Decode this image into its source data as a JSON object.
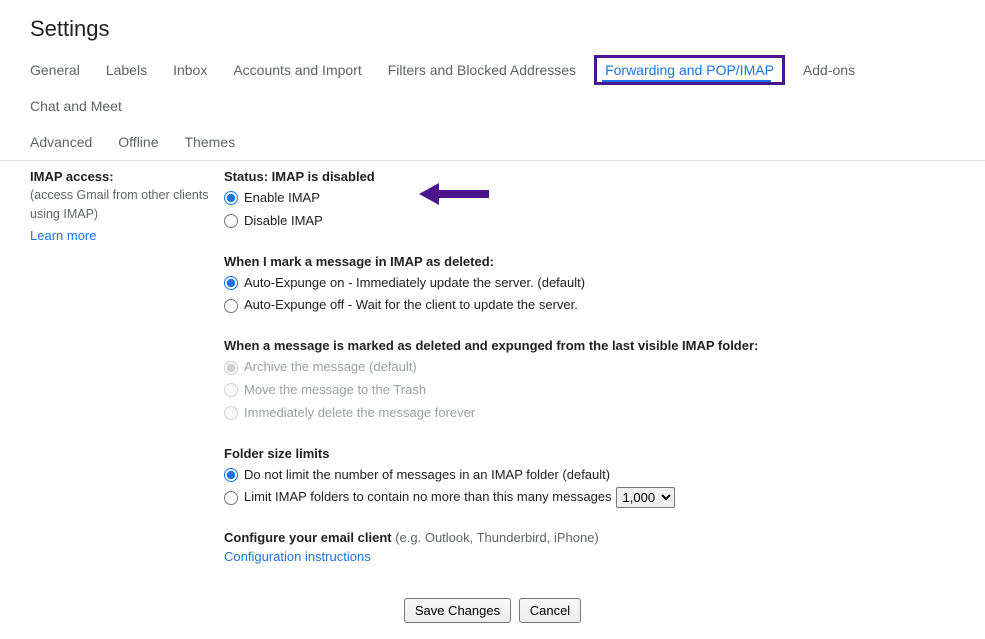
{
  "page_title": "Settings",
  "tabs": {
    "general": "General",
    "labels": "Labels",
    "inbox": "Inbox",
    "accounts": "Accounts and Import",
    "filters": "Filters and Blocked Addresses",
    "forwarding": "Forwarding and POP/IMAP",
    "addons": "Add-ons",
    "chat": "Chat and Meet",
    "advanced": "Advanced",
    "offline": "Offline",
    "themes": "Themes"
  },
  "left": {
    "title": "IMAP access:",
    "desc": "(access Gmail from other clients using IMAP)",
    "learn": "Learn more"
  },
  "status": {
    "title": "Status: IMAP is disabled",
    "enable": "Enable IMAP",
    "disable": "Disable IMAP"
  },
  "deleted": {
    "title": "When I mark a message in IMAP as deleted:",
    "opt_on": "Auto-Expunge on - Immediately update the server. (default)",
    "opt_off": "Auto-Expunge off - Wait for the client to update the server."
  },
  "expunged": {
    "title": "When a message is marked as deleted and expunged from the last visible IMAP folder:",
    "opt_archive": "Archive the message (default)",
    "opt_trash": "Move the message to the Trash",
    "opt_delete": "Immediately delete the message forever"
  },
  "folder": {
    "title": "Folder size limits",
    "opt_nolimit": "Do not limit the number of messages in an IMAP folder (default)",
    "opt_limit": "Limit IMAP folders to contain no more than this many messages",
    "limit_value": "1,000"
  },
  "configure": {
    "title": "Configure your email client",
    "hint": " (e.g. Outlook, Thunderbird, iPhone)",
    "link": "Configuration instructions"
  },
  "buttons": {
    "save": "Save Changes",
    "cancel": "Cancel"
  }
}
